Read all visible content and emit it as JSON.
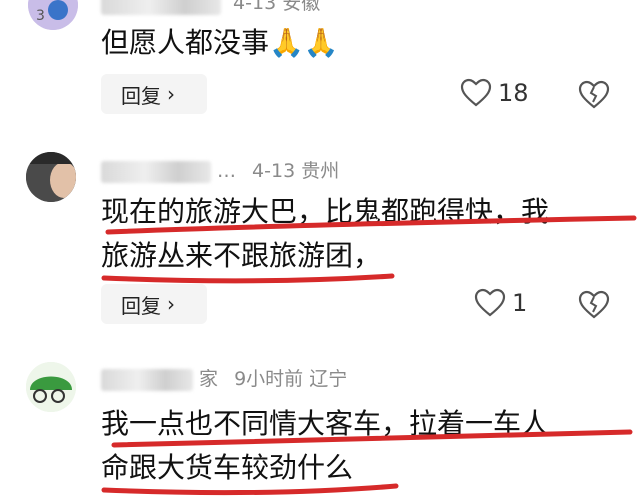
{
  "comments": [
    {
      "meta": "4-13  安徽",
      "text_lines": [
        "但愿人都没事🙏🙏"
      ],
      "reply_label": "回复",
      "like_count": "18"
    },
    {
      "meta_suffix": "…",
      "meta": "4-13  贵州",
      "text_lines": [
        "现在的旅游大巴，比鬼都跑得快，我",
        "旅游丛来不跟旅游团，"
      ],
      "reply_label": "回复",
      "like_count": "1"
    },
    {
      "meta_suffix": "家",
      "meta": "9小时前  辽宁",
      "text_lines": [
        "我一点也不同情大客车，拉着一车人",
        "命跟大货车较劲什么"
      ]
    }
  ],
  "icons": {
    "reply_chevron": "chevron-right-icon",
    "like": "heart-outline-icon",
    "dislike": "broken-heart-icon"
  },
  "colors": {
    "underline": "#d62a2a",
    "meta": "#8a8a8a",
    "reply_bg": "#f4f4f4"
  }
}
